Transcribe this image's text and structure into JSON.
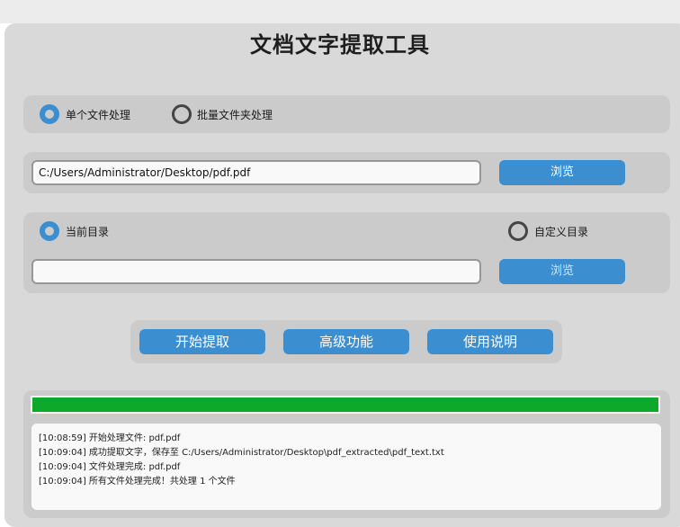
{
  "app": {
    "title": "文档文字提取工具"
  },
  "mode": {
    "single_label": "单个文件处理",
    "batch_label": "批量文件夹处理",
    "selected": "single"
  },
  "file": {
    "path_value": "C:/Users/Administrator/Desktop/pdf.pdf",
    "browse_label": "浏览"
  },
  "output": {
    "current_dir_label": "当前目录",
    "custom_dir_label": "自定义目录",
    "selected": "current",
    "dir_value": "",
    "browse_label": "浏览"
  },
  "actions": {
    "start_label": "开始提取",
    "advanced_label": "高级功能",
    "help_label": "使用说明"
  },
  "progress": {
    "value": 1.0
  },
  "log": {
    "lines": [
      "[10:08:59] 开始处理文件: pdf.pdf",
      "[10:09:04] 成功提取文字，保存至 C:/Users/Administrator/Desktop\\pdf_extracted\\pdf_text.txt",
      "[10:09:04] 文件处理完成: pdf.pdf",
      "[10:09:04] 所有文件处理完成！共处理 1 个文件"
    ]
  },
  "colors": {
    "accent": "#3b8ed0",
    "progress": "#0ca92a",
    "panel": "#cbcbcb",
    "window": "#d9d9d9"
  }
}
